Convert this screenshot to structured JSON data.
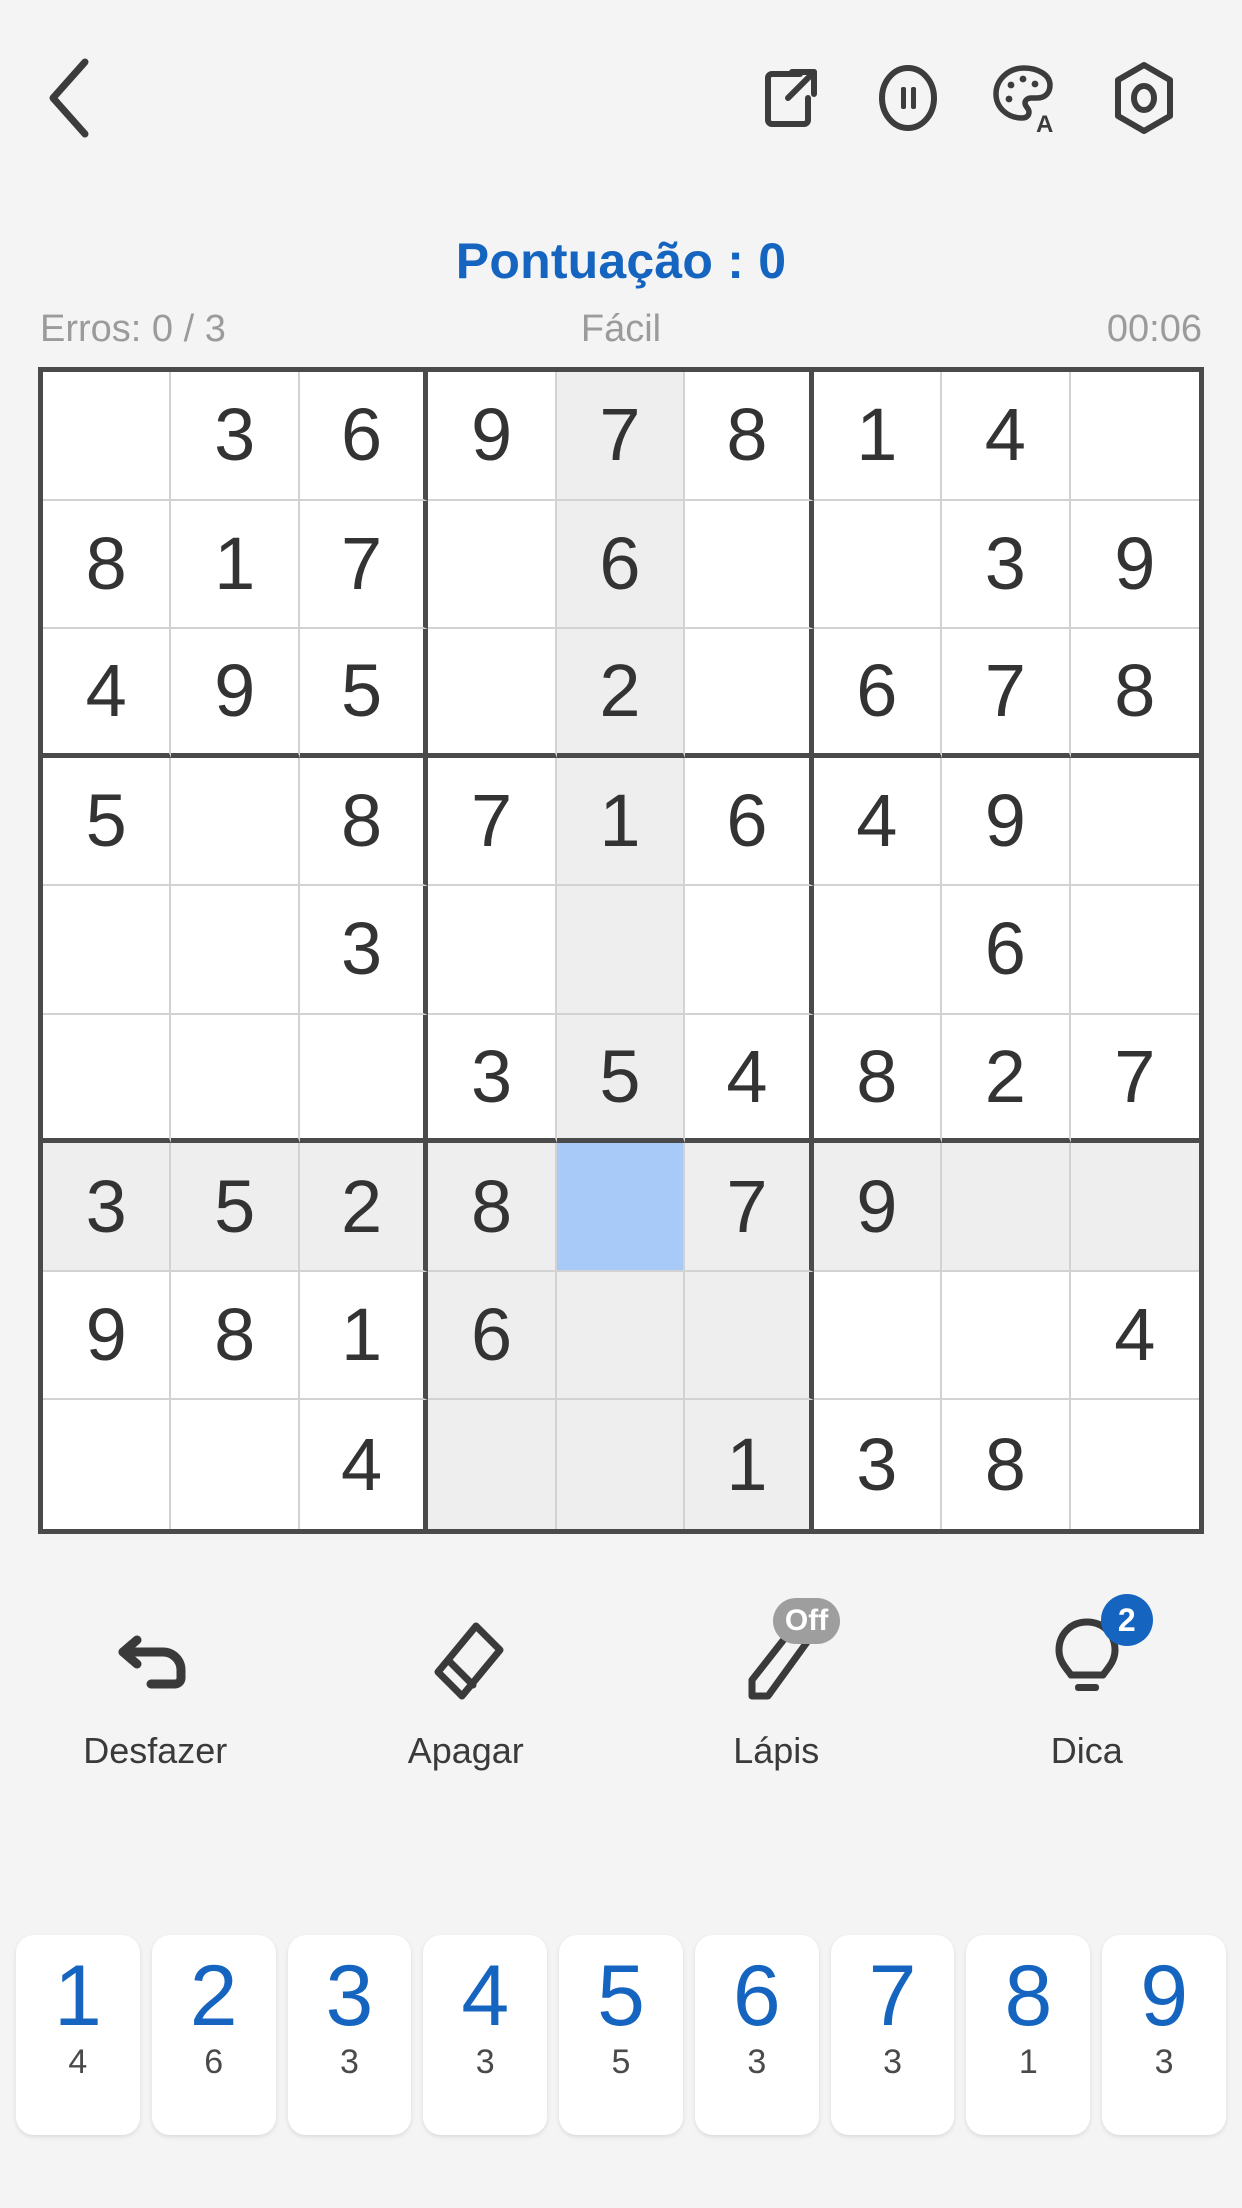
{
  "header": {
    "back_icon": "chevron-left-icon",
    "actions": [
      {
        "name": "share-button",
        "icon": "share-export-icon"
      },
      {
        "name": "pause-button",
        "icon": "pause-circle-icon"
      },
      {
        "name": "theme-button",
        "icon": "palette-auto-icon"
      },
      {
        "name": "settings-button",
        "icon": "gear-hex-icon"
      }
    ]
  },
  "score": {
    "text": "Pontuação : 0",
    "color": "#1565C0"
  },
  "status": {
    "errors": "Erros: 0 / 3",
    "difficulty": "Fácil",
    "timer": "00:06"
  },
  "board": {
    "selected": {
      "row": 6,
      "col": 4
    },
    "highlight_color": "#eeeeee",
    "selected_color": "#a8caf8",
    "rows": [
      [
        "",
        "3",
        "6",
        "9",
        "7",
        "8",
        "1",
        "4",
        ""
      ],
      [
        "8",
        "1",
        "7",
        "",
        "6",
        "",
        "",
        "3",
        "9"
      ],
      [
        "4",
        "9",
        "5",
        "",
        "2",
        "",
        "6",
        "7",
        "8"
      ],
      [
        "5",
        "",
        "8",
        "7",
        "1",
        "6",
        "4",
        "9",
        ""
      ],
      [
        "",
        "",
        "3",
        "",
        "",
        "",
        "",
        "6",
        ""
      ],
      [
        "",
        "",
        "",
        "3",
        "5",
        "4",
        "8",
        "2",
        "7"
      ],
      [
        "3",
        "5",
        "2",
        "8",
        "",
        "7",
        "9",
        "",
        ""
      ],
      [
        "9",
        "8",
        "1",
        "6",
        "",
        "",
        "",
        "",
        "4"
      ],
      [
        "",
        "",
        "4",
        "",
        "",
        "1",
        "3",
        "8",
        ""
      ]
    ]
  },
  "tools": [
    {
      "name": "undo-button",
      "label": "Desfazer",
      "icon": "undo-arrow-icon",
      "badge": null,
      "badge_type": null
    },
    {
      "name": "erase-button",
      "label": "Apagar",
      "icon": "eraser-icon",
      "badge": null,
      "badge_type": null
    },
    {
      "name": "pencil-button",
      "label": "Lápis",
      "icon": "pencil-icon",
      "badge": "Off",
      "badge_type": "off"
    },
    {
      "name": "hint-button",
      "label": "Dica",
      "icon": "lightbulb-icon",
      "badge": "2",
      "badge_type": "count"
    }
  ],
  "numpad": [
    {
      "digit": "1",
      "count": "4"
    },
    {
      "digit": "2",
      "count": "6"
    },
    {
      "digit": "3",
      "count": "3"
    },
    {
      "digit": "4",
      "count": "3"
    },
    {
      "digit": "5",
      "count": "5"
    },
    {
      "digit": "6",
      "count": "3"
    },
    {
      "digit": "7",
      "count": "3"
    },
    {
      "digit": "8",
      "count": "1"
    },
    {
      "digit": "9",
      "count": "3"
    }
  ]
}
